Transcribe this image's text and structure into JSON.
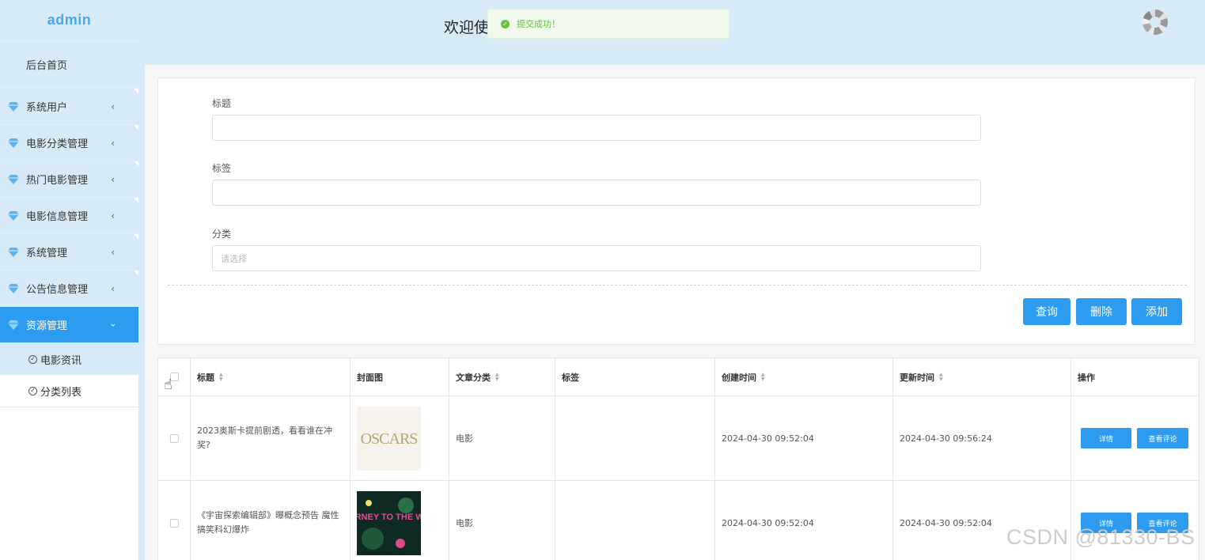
{
  "sidebar": {
    "logo": "admin",
    "home": "后台首页",
    "items": [
      {
        "label": "系统用户",
        "icon": "gem-icon"
      },
      {
        "label": "电影分类管理",
        "icon": "gem-icon"
      },
      {
        "label": "热门电影管理",
        "icon": "gem-icon"
      },
      {
        "label": "电影信息管理",
        "icon": "gem-icon"
      },
      {
        "label": "系统管理",
        "icon": "gem-icon"
      },
      {
        "label": "公告信息管理",
        "icon": "gem-icon"
      },
      {
        "label": "资源管理",
        "icon": "gem-icon"
      }
    ],
    "subitems": [
      {
        "label": "电影资讯"
      },
      {
        "label": "分类列表"
      }
    ],
    "active_color": "#2d9cf0"
  },
  "header": {
    "welcome": "欢迎使",
    "toast": "提交成功！"
  },
  "form": {
    "title_label": "标题",
    "title_value": "",
    "tag_label": "标签",
    "tag_value": "",
    "category_label": "分类",
    "category_placeholder": "请选择",
    "query_button": "查询",
    "delete_button": "删除",
    "add_button": "添加"
  },
  "table": {
    "columns": [
      "标题",
      "封面图",
      "文章分类",
      "标签",
      "创建时间",
      "更新时间",
      "操作"
    ],
    "rows": [
      {
        "title": "2023奥斯卡提前剧透，看看谁在冲奖?",
        "cover": "OSCARS",
        "category": "电影",
        "tag": "",
        "created": "2024-04-30 09:52:04",
        "updated": "2024-04-30 09:56:24",
        "detail": "详情",
        "comments": "查看评论"
      },
      {
        "title": "《宇宙探索编辑部》曝概念预告 魔性搞笑科幻爆炸",
        "cover": "JOURNEY TO THE WEST",
        "category": "电影",
        "tag": "",
        "created": "2024-04-30 09:52:04",
        "updated": "2024-04-30 09:52:04",
        "detail": "详情",
        "comments": "查看评论"
      }
    ]
  },
  "watermark": "CSDN @81330-BS"
}
